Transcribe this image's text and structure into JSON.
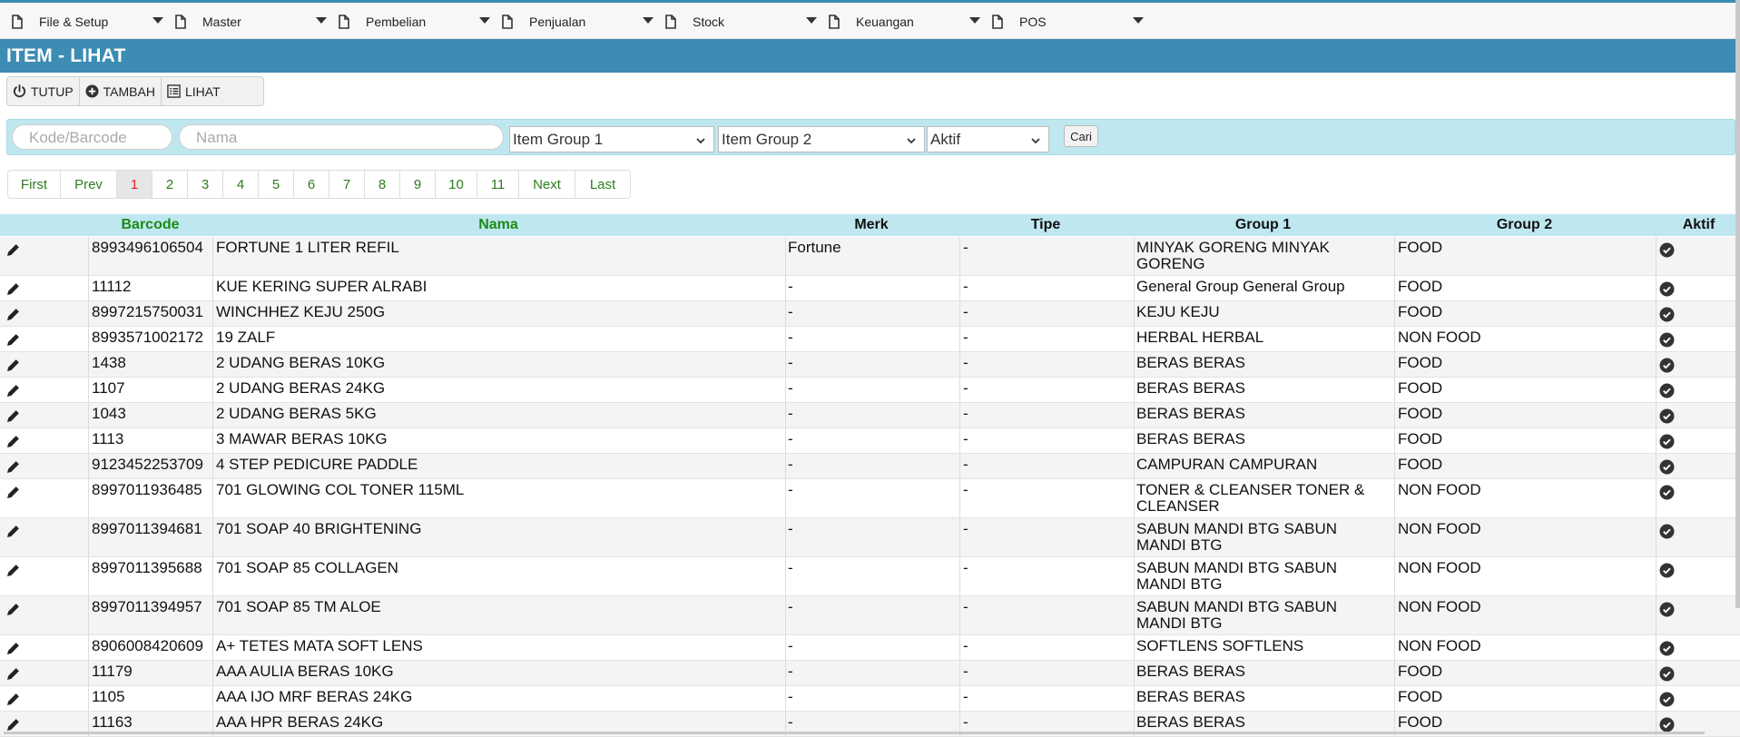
{
  "menu": [
    {
      "label": "File & Setup"
    },
    {
      "label": "Master"
    },
    {
      "label": "Pembelian"
    },
    {
      "label": "Penjualan"
    },
    {
      "label": "Stock"
    },
    {
      "label": "Keuangan"
    },
    {
      "label": "POS"
    }
  ],
  "page_title": "ITEM - LIHAT",
  "toolbar": {
    "close_label": "TUTUP",
    "add_label": "TAMBAH",
    "view_label": "LIHAT"
  },
  "filters": {
    "code_placeholder": "Kode/Barcode",
    "name_placeholder": "Nama",
    "group1_selected": "Item Group 1",
    "group2_selected": "Item Group 2",
    "status_selected": "Aktif",
    "search_label": "Cari"
  },
  "pagination": {
    "first": "First",
    "prev": "Prev",
    "pages": [
      "1",
      "2",
      "3",
      "4",
      "5",
      "6",
      "7",
      "8",
      "9",
      "10",
      "11"
    ],
    "current": "1",
    "next": "Next",
    "last": "Last"
  },
  "table": {
    "headers": {
      "barcode": "Barcode",
      "nama": "Nama",
      "merk": "Merk",
      "tipe": "Tipe",
      "group1": "Group 1",
      "group2": "Group 2",
      "aktif": "Aktif"
    },
    "rows": [
      {
        "barcode": "8993496106504",
        "nama": "FORTUNE 1 LITER REFIL",
        "merk": "Fortune",
        "tipe": "-",
        "group1": "MINYAK GORENG MINYAK GORENG",
        "group2": "FOOD",
        "aktif": true
      },
      {
        "barcode": "11112",
        "nama": "KUE KERING SUPER ALRABI",
        "merk": "-",
        "tipe": "-",
        "group1": "General Group General Group",
        "group2": "FOOD",
        "aktif": true
      },
      {
        "barcode": "8997215750031",
        "nama": "WINCHHEZ KEJU 250G",
        "merk": "-",
        "tipe": "-",
        "group1": "KEJU KEJU",
        "group2": "FOOD",
        "aktif": true
      },
      {
        "barcode": "8993571002172",
        "nama": "19 ZALF",
        "merk": "-",
        "tipe": "-",
        "group1": "HERBAL HERBAL",
        "group2": "NON FOOD",
        "aktif": true
      },
      {
        "barcode": "1438",
        "nama": "2 UDANG BERAS 10KG",
        "merk": "-",
        "tipe": "-",
        "group1": "BERAS BERAS",
        "group2": "FOOD",
        "aktif": true
      },
      {
        "barcode": "1107",
        "nama": "2 UDANG BERAS 24KG",
        "merk": "-",
        "tipe": "-",
        "group1": "BERAS BERAS",
        "group2": "FOOD",
        "aktif": true
      },
      {
        "barcode": "1043",
        "nama": "2 UDANG BERAS 5KG",
        "merk": "-",
        "tipe": "-",
        "group1": "BERAS BERAS",
        "group2": "FOOD",
        "aktif": true
      },
      {
        "barcode": "1113",
        "nama": "3 MAWAR BERAS 10KG",
        "merk": "-",
        "tipe": "-",
        "group1": "BERAS BERAS",
        "group2": "FOOD",
        "aktif": true
      },
      {
        "barcode": "9123452253709",
        "nama": "4 STEP PEDICURE PADDLE",
        "merk": "-",
        "tipe": "-",
        "group1": "CAMPURAN CAMPURAN",
        "group2": "FOOD",
        "aktif": true
      },
      {
        "barcode": "8997011936485",
        "nama": "701 GLOWING COL TONER 115ML",
        "merk": "-",
        "tipe": "-",
        "group1": "TONER & CLEANSER TONER & CLEANSER",
        "group2": "NON FOOD",
        "aktif": true
      },
      {
        "barcode": "8997011394681",
        "nama": "701 SOAP 40 BRIGHTENING",
        "merk": "-",
        "tipe": "-",
        "group1": "SABUN MANDI BTG SABUN MANDI BTG",
        "group2": "NON FOOD",
        "aktif": true
      },
      {
        "barcode": "8997011395688",
        "nama": "701 SOAP 85 COLLAGEN",
        "merk": "-",
        "tipe": "-",
        "group1": "SABUN MANDI BTG SABUN MANDI BTG",
        "group2": "NON FOOD",
        "aktif": true
      },
      {
        "barcode": "8997011394957",
        "nama": "701 SOAP 85 TM ALOE",
        "merk": "-",
        "tipe": "-",
        "group1": "SABUN MANDI BTG SABUN MANDI BTG",
        "group2": "NON FOOD",
        "aktif": true
      },
      {
        "barcode": "8906008420609",
        "nama": "A+ TETES MATA SOFT LENS",
        "merk": "-",
        "tipe": "-",
        "group1": "SOFTLENS SOFTLENS",
        "group2": "NON FOOD",
        "aktif": true
      },
      {
        "barcode": "11179",
        "nama": "AAA AULIA BERAS 10KG",
        "merk": "-",
        "tipe": "-",
        "group1": "BERAS BERAS",
        "group2": "FOOD",
        "aktif": true
      },
      {
        "barcode": "1105",
        "nama": "AAA IJO MRF BERAS 24KG",
        "merk": "-",
        "tipe": "-",
        "group1": "BERAS BERAS",
        "group2": "FOOD",
        "aktif": true
      },
      {
        "barcode": "11163",
        "nama": "AAA HPR BERAS 24KG",
        "merk": "-",
        "tipe": "-",
        "group1": "BERAS BERAS",
        "group2": "FOOD",
        "aktif": true
      }
    ]
  },
  "icons": {
    "menu_item": "document-icon",
    "menu_caret": "caret-down-icon",
    "close": "power-icon",
    "add": "plus-circle-icon",
    "view": "list-icon",
    "select_chevron": "chevron-down-icon",
    "row_edit": "pencil-icon",
    "row_active": "check-circle-icon"
  },
  "colors": {
    "accent": "#3c8cb3",
    "filter_bg": "#bfe7f0",
    "header_green": "#1e8a16",
    "active_page": "#d22222"
  }
}
